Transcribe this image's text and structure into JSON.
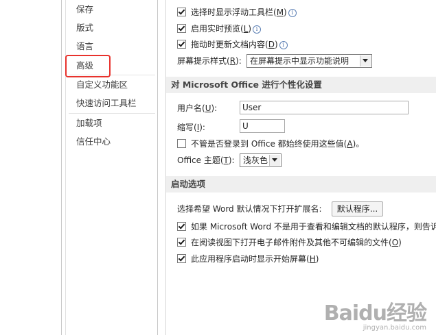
{
  "nav": {
    "items": [
      {
        "label": "保存"
      },
      {
        "label": "版式"
      },
      {
        "label": "语言"
      },
      {
        "label": "高级"
      },
      {
        "label": "自定义功能区"
      },
      {
        "label": "快速访问工具栏"
      },
      {
        "label": "加载项"
      },
      {
        "label": "信任中心"
      }
    ]
  },
  "display": {
    "mini_toolbar": {
      "text": "选择时显示浮动工具栏(",
      "key": "M",
      "end": ")"
    },
    "live_preview": {
      "text": "启用实时预览(",
      "key": "L",
      "end": ")"
    },
    "update_drag": {
      "text": "拖动时更新文档内容(",
      "key": "D",
      "end": ")"
    },
    "screentip": {
      "text": "屏幕提示样式(",
      "key": "R",
      "end": "):",
      "value": "在屏幕提示中显示功能说明"
    }
  },
  "personalize": {
    "title": "对 Microsoft Office 进行个性化设置",
    "username": {
      "text": "用户名(",
      "key": "U",
      "end": "):",
      "value": "User"
    },
    "initials": {
      "text": "缩写(",
      "key": "I",
      "end": "):",
      "value": "U"
    },
    "always_use": {
      "text": "不管是否登录到 Office 都始终使用这些值(",
      "key": "A",
      "end": ")。"
    },
    "theme": {
      "text": "Office 主题(",
      "key": "T",
      "end": "):",
      "value": "浅灰色"
    }
  },
  "startup": {
    "title": "启动选项",
    "extensions": {
      "text": "选择希望 Word 默认情况下打开扩展名:",
      "button": "默认程序..."
    },
    "tell_me": {
      "text": "如果 Microsoft Word 不是用于查看和编辑文档的默认程序，则告诉"
    },
    "reading_view": {
      "text": "在阅读视图下打开电子邮件附件及其他不可编辑的文件(",
      "key": "O",
      "end": ")"
    },
    "start_screen": {
      "text": "此应用程序启动时显示开始屏幕(",
      "key": "H",
      "end": ")"
    }
  },
  "watermark": {
    "brand": "Baidu经验",
    "sub": "jingyan.baidu.com"
  },
  "colors": {
    "highlight": "#e8322c",
    "section_bg": "#efefef",
    "info": "#3e64a3"
  }
}
